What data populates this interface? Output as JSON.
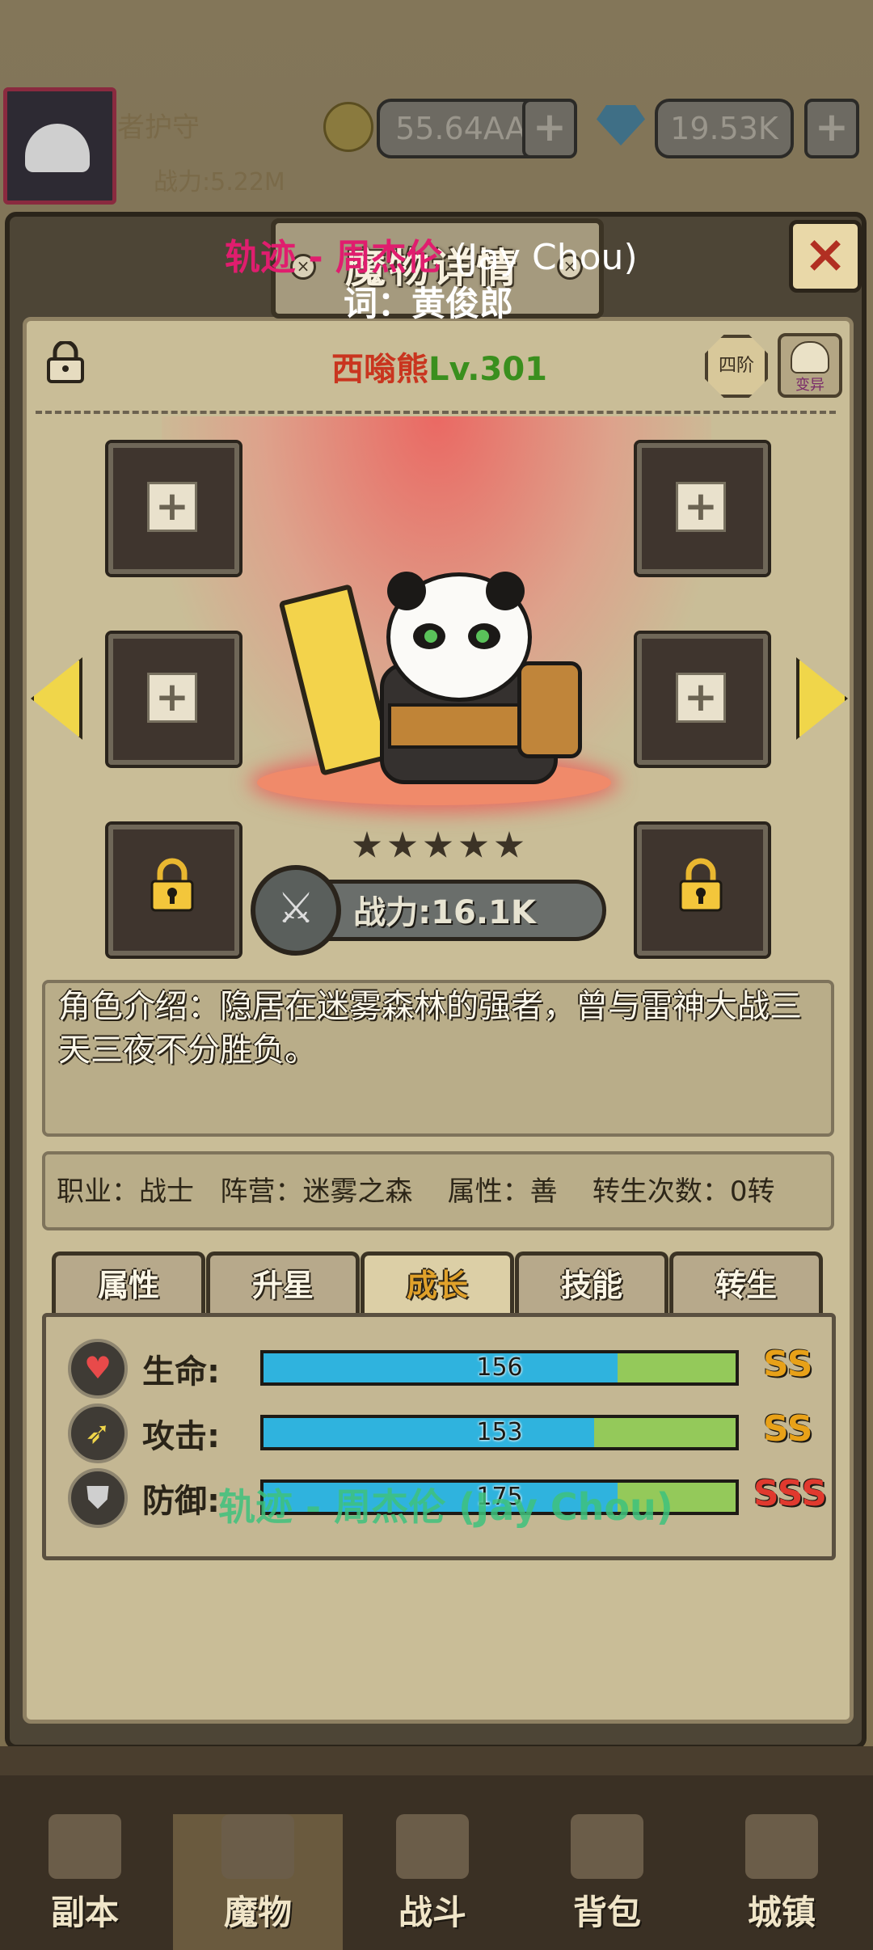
{
  "hud": {
    "player_name": "者护守",
    "power": "战力:5.22M",
    "gold": "55.64AA",
    "gems": "19.53K",
    "plus": "+"
  },
  "dialog": {
    "title": "魔物详情",
    "close": "×",
    "rank": "四阶",
    "mutate": "变异",
    "monster_name": "西嗡熊",
    "monster_level": "Lv.301",
    "stars": 5,
    "power": "战力:16.1K",
    "intro": "角色介绍：隐居在迷雾森林的强者，曾与雷神大战三天三夜不分胜负。",
    "info": "职业：战士   阵营：迷雾之森    属性：善    转生次数：0转",
    "tabs": [
      "属性",
      "升星",
      "成长",
      "技能",
      "转生"
    ],
    "active_tab": 2,
    "stats": [
      {
        "label": "生命:",
        "value": "156",
        "fill_pct": 75,
        "grade": "SS",
        "grade_color": "#e8a118",
        "icon": "heart-icon"
      },
      {
        "label": "攻击:",
        "value": "153",
        "fill_pct": 70,
        "grade": "SS",
        "grade_color": "#e8a118",
        "icon": "sword-icon"
      },
      {
        "label": "防御:",
        "value": "175",
        "fill_pct": 75,
        "grade": "SSS",
        "grade_color": "#e0392e",
        "icon": "shield-icon"
      }
    ]
  },
  "lyrics": {
    "top_red": "轨迹 - 周杰伦",
    "top_white": " (Jay Chou)",
    "sub": "词：黄俊郎",
    "bottom": "轨迹 - 周杰伦 (Jay Chou)"
  },
  "nav": [
    "副本",
    "魔物",
    "战斗",
    "背包",
    "城镇"
  ],
  "nav_active": 1,
  "colors": {
    "accent_gold": "#f0d64a",
    "hp_bar": "#2fb3de",
    "bar_bg": "#94c95a"
  }
}
